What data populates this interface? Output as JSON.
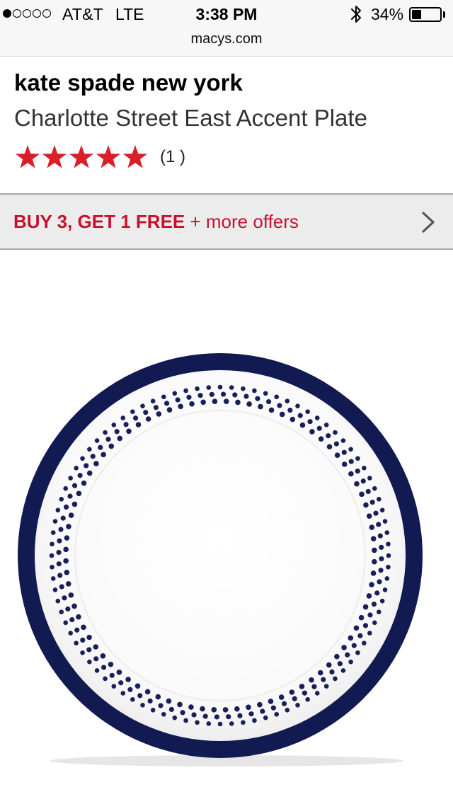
{
  "status_bar": {
    "carrier": "AT&T",
    "network": "LTE",
    "time": "3:38 PM",
    "battery_percent": "34%",
    "battery_level": 0.34,
    "signal_bars_filled": 1,
    "signal_bars_total": 5
  },
  "browser": {
    "url": "macys.com"
  },
  "product": {
    "brand": "kate spade new york",
    "title": "Charlotte Street East Accent Plate",
    "rating_stars": 5,
    "review_count": "(1 )",
    "star_color": "#d81f2a"
  },
  "offers": {
    "promo": "BUY 3, GET 1 FREE",
    "more": " + more offers",
    "color": "#c8102e"
  },
  "image": {
    "subject": "plate-image",
    "rim_color": "#121a52",
    "dot_color": "#18205a"
  }
}
